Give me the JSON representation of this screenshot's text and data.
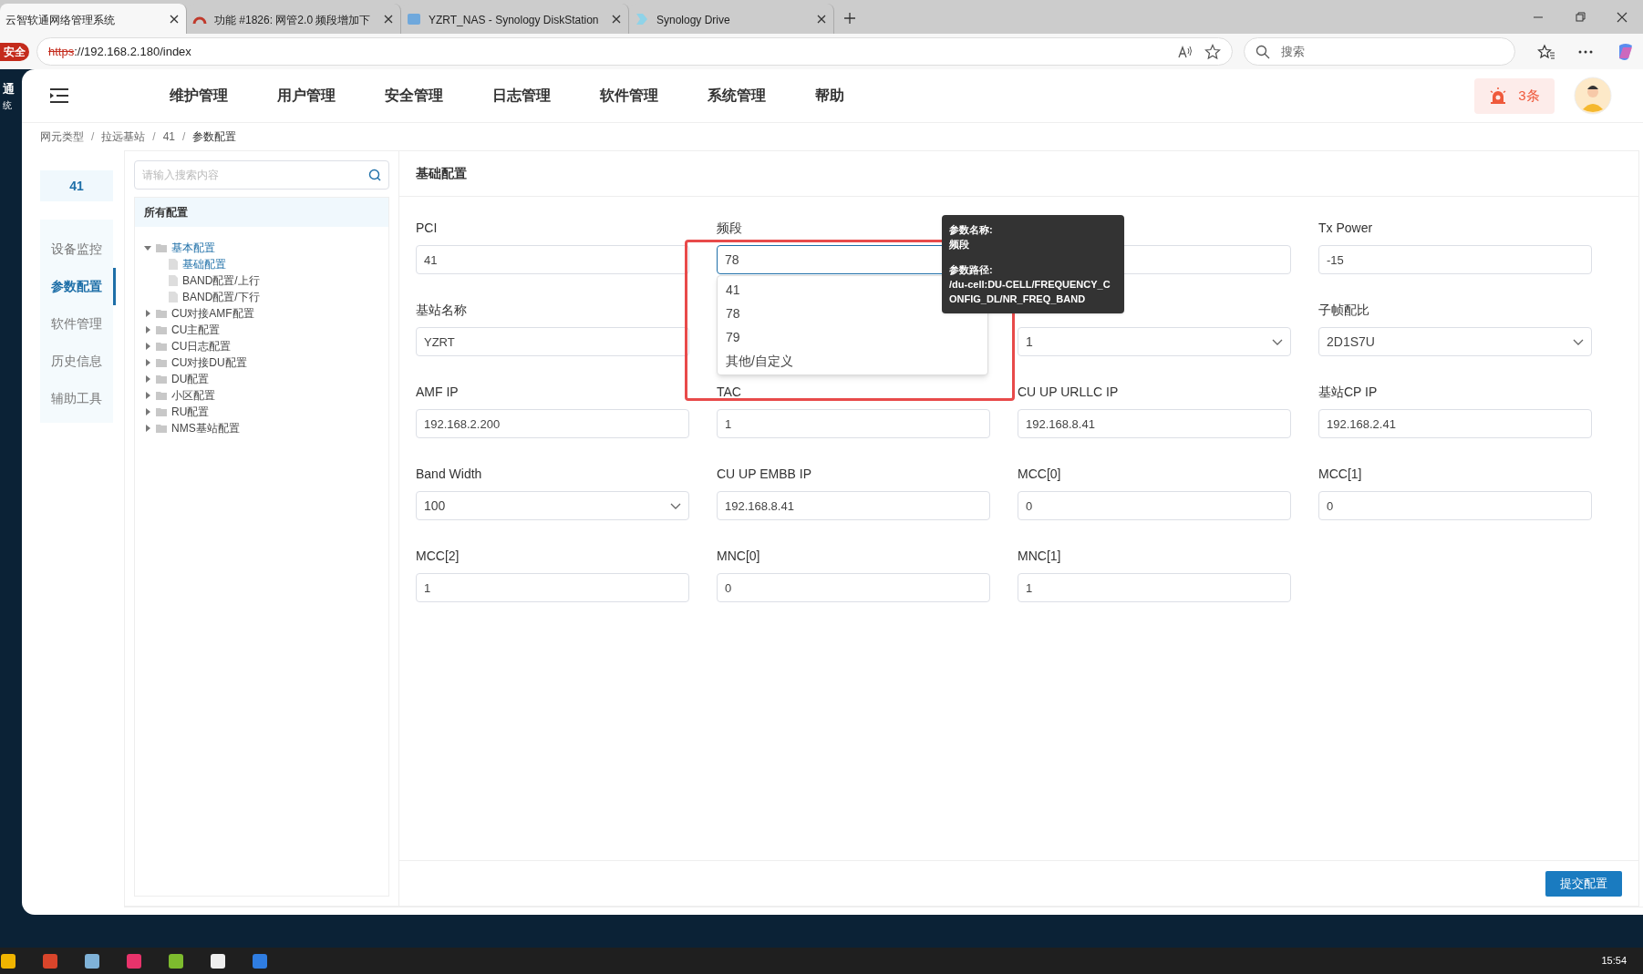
{
  "browser": {
    "tabs": [
      {
        "title": "云智软通网络管理系统",
        "selected": true
      },
      {
        "title": "功能 #1826: 网管2.0 频段增加下",
        "selected": false
      },
      {
        "title": "YZRT_NAS - Synology DiskStation",
        "selected": false
      },
      {
        "title": "Synology Drive",
        "selected": false
      }
    ],
    "security_badge": "安全",
    "url_scheme": "https",
    "url_rest": "://192.168.2.180/index",
    "search_placeholder": "搜索"
  },
  "app_strip": {
    "line_1": "通",
    "line_2": "统"
  },
  "header": {
    "menu": [
      {
        "label": "维护管理"
      },
      {
        "label": "用户管理"
      },
      {
        "label": "安全管理"
      },
      {
        "label": "日志管理"
      },
      {
        "label": "软件管理"
      },
      {
        "label": "系统管理"
      },
      {
        "label": "帮助"
      }
    ],
    "alarm_count": "3条"
  },
  "breadcrumb": [
    "网元类型",
    "拉远基站",
    "41",
    "参数配置"
  ],
  "breadcrumb_separator": "/",
  "device": "41",
  "nav": [
    {
      "label": "设备监控",
      "selected": false
    },
    {
      "label": "参数配置",
      "selected": true
    },
    {
      "label": "软件管理",
      "selected": false
    },
    {
      "label": "历史信息",
      "selected": false
    },
    {
      "label": "辅助工具",
      "selected": false
    }
  ],
  "tree": {
    "search_placeholder": "请输入搜索内容",
    "title": "所有配置",
    "items": [
      {
        "label": "基本配置",
        "kind": "folder",
        "expanded": true,
        "selected": true,
        "children": [
          {
            "label": "基础配置",
            "kind": "file",
            "selected": true
          },
          {
            "label": "BAND配置/上行",
            "kind": "file",
            "selected": false
          },
          {
            "label": "BAND配置/下行",
            "kind": "file",
            "selected": false
          }
        ]
      },
      {
        "label": "CU对接AMF配置",
        "kind": "folder",
        "expanded": false,
        "selected": false
      },
      {
        "label": "CU主配置",
        "kind": "folder",
        "expanded": false,
        "selected": false
      },
      {
        "label": "CU日志配置",
        "kind": "folder",
        "expanded": false,
        "selected": false
      },
      {
        "label": "CU对接DU配置",
        "kind": "folder",
        "expanded": false,
        "selected": false
      },
      {
        "label": "DU配置",
        "kind": "folder",
        "expanded": false,
        "selected": false
      },
      {
        "label": "小区配置",
        "kind": "folder",
        "expanded": false,
        "selected": false
      },
      {
        "label": "RU配置",
        "kind": "folder",
        "expanded": false,
        "selected": false
      },
      {
        "label": "NMS基站配置",
        "kind": "folder",
        "expanded": false,
        "selected": false
      }
    ]
  },
  "form": {
    "title": "基础配置",
    "rows": [
      [
        {
          "label": "PCI",
          "kind": "input",
          "value": "41"
        },
        {
          "label": "频段",
          "kind": "select",
          "value": "78",
          "open": true,
          "options": [
            "41",
            "78",
            "79",
            "其他/自定义"
          ]
        },
        {
          "kind": "input"
        },
        {
          "label": "Tx Power",
          "kind": "input",
          "value": "-15"
        }
      ],
      [
        {
          "label": "基站名称",
          "kind": "input",
          "value": "YZRT"
        },
        null,
        {
          "kind": "select",
          "value": "1",
          "open": false
        },
        {
          "label": "子帧配比",
          "kind": "select",
          "value": "2D1S7U",
          "open": false
        }
      ],
      [
        {
          "label": "AMF IP",
          "kind": "input",
          "value": "192.168.2.200"
        },
        {
          "label": "TAC",
          "kind": "input",
          "value": "1"
        },
        {
          "label": "CU UP URLLC IP",
          "kind": "input",
          "value": "192.168.8.41"
        },
        {
          "label": "基站CP IP",
          "kind": "input",
          "value": "192.168.2.41"
        }
      ],
      [
        {
          "label": "Band Width",
          "kind": "select",
          "value": "100",
          "open": false
        },
        {
          "label": "CU UP EMBB IP",
          "kind": "input",
          "value": "192.168.8.41"
        },
        {
          "label": "MCC[0]",
          "kind": "input",
          "value": "0"
        },
        {
          "label": "MCC[1]",
          "kind": "input",
          "value": "0"
        }
      ],
      [
        {
          "label": "MCC[2]",
          "kind": "input",
          "value": "1"
        },
        {
          "label": "MNC[0]",
          "kind": "input",
          "value": "0"
        },
        {
          "label": "MNC[1]",
          "kind": "input",
          "value": "1"
        }
      ]
    ],
    "tooltip": {
      "name_label": "参数名称:",
      "name": "频段",
      "path_label": "参数路径:",
      "path": "/du-cell:DU-CELL/FREQUENCY_CONFIG_DL/NR_FREQ_BAND"
    },
    "submit": "提交配置"
  },
  "taskbar": {
    "time": "15:54"
  }
}
